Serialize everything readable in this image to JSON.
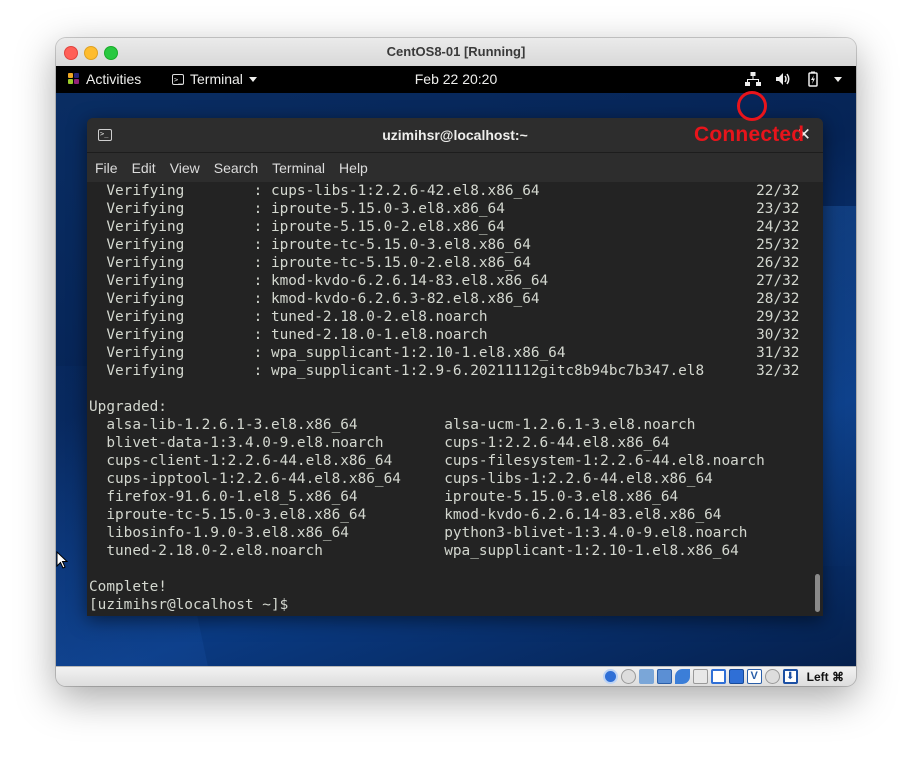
{
  "host_window": {
    "title": "CentOS8-01 [Running]"
  },
  "gnome_topbar": {
    "activities": "Activities",
    "app_menu": "Terminal",
    "clock": "Feb 22  20:20"
  },
  "annotation": {
    "label": "Connected",
    "color": "#e8141b"
  },
  "terminal": {
    "title": "uzimihsr@localhost:~",
    "menu": [
      "File",
      "Edit",
      "View",
      "Search",
      "Terminal",
      "Help"
    ],
    "output": "  Verifying        : cups-libs-1:2.2.6-42.el8.x86_64                         22/32\n  Verifying        : iproute-5.15.0-3.el8.x86_64                             23/32\n  Verifying        : iproute-5.15.0-2.el8.x86_64                             24/32\n  Verifying        : iproute-tc-5.15.0-3.el8.x86_64                          25/32\n  Verifying        : iproute-tc-5.15.0-2.el8.x86_64                          26/32\n  Verifying        : kmod-kvdo-6.2.6.14-83.el8.x86_64                        27/32\n  Verifying        : kmod-kvdo-6.2.6.3-82.el8.x86_64                         28/32\n  Verifying        : tuned-2.18.0-2.el8.noarch                               29/32\n  Verifying        : tuned-2.18.0-1.el8.noarch                               30/32\n  Verifying        : wpa_supplicant-1:2.10-1.el8.x86_64                      31/32\n  Verifying        : wpa_supplicant-1:2.9-6.20211112gitc8b94bc7b347.el8      32/32\n\nUpgraded:\n  alsa-lib-1.2.6.1-3.el8.x86_64          alsa-ucm-1.2.6.1-3.el8.noarch\n  blivet-data-1:3.4.0-9.el8.noarch       cups-1:2.2.6-44.el8.x86_64\n  cups-client-1:2.2.6-44.el8.x86_64      cups-filesystem-1:2.2.6-44.el8.noarch\n  cups-ipptool-1:2.2.6-44.el8.x86_64     cups-libs-1:2.2.6-44.el8.x86_64\n  firefox-91.6.0-1.el8_5.x86_64          iproute-5.15.0-3.el8.x86_64\n  iproute-tc-5.15.0-3.el8.x86_64         kmod-kvdo-6.2.6.14-83.el8.x86_64\n  libosinfo-1.9.0-3.el8.x86_64           python3-blivet-1:3.4.0-9.el8.noarch\n  tuned-2.18.0-2.el8.noarch              wpa_supplicant-1:2.10-1.el8.x86_64\n\nComplete!\n[uzimihsr@localhost ~]$ "
  },
  "vbox_statusbar": {
    "host_key": "Left ⌘"
  }
}
